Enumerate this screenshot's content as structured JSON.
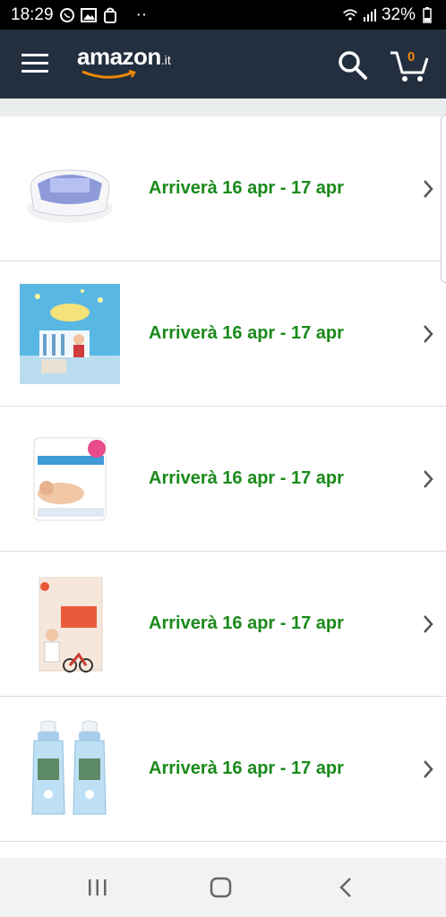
{
  "status_bar": {
    "time": "18:29",
    "dots": "··",
    "battery_pct": "32%",
    "icons": [
      "whatsapp-icon",
      "gallery-icon",
      "shopping-bag-icon",
      "wifi-icon",
      "signal-icon",
      "battery-icon"
    ]
  },
  "header": {
    "logo_text": "amazon",
    "logo_tld": ".it",
    "cart_count": "0",
    "colors": {
      "bg": "#232f3e",
      "smile": "#f08804"
    }
  },
  "orders": [
    {
      "product": "sterilizer",
      "delivery": "Arriverà 16 apr - 17 apr"
    },
    {
      "product": "wall-decal",
      "delivery": "Arriverà 16 apr - 17 apr"
    },
    {
      "product": "waterwipes",
      "delivery": "Arriverà 16 apr - 17 apr"
    },
    {
      "product": "book",
      "delivery": "Arriverà 16 apr - 17 apr"
    },
    {
      "product": "bottles",
      "delivery": "Arriverà 16 apr - 17 apr"
    }
  ],
  "colors": {
    "delivery_green": "#1a8a1a"
  }
}
